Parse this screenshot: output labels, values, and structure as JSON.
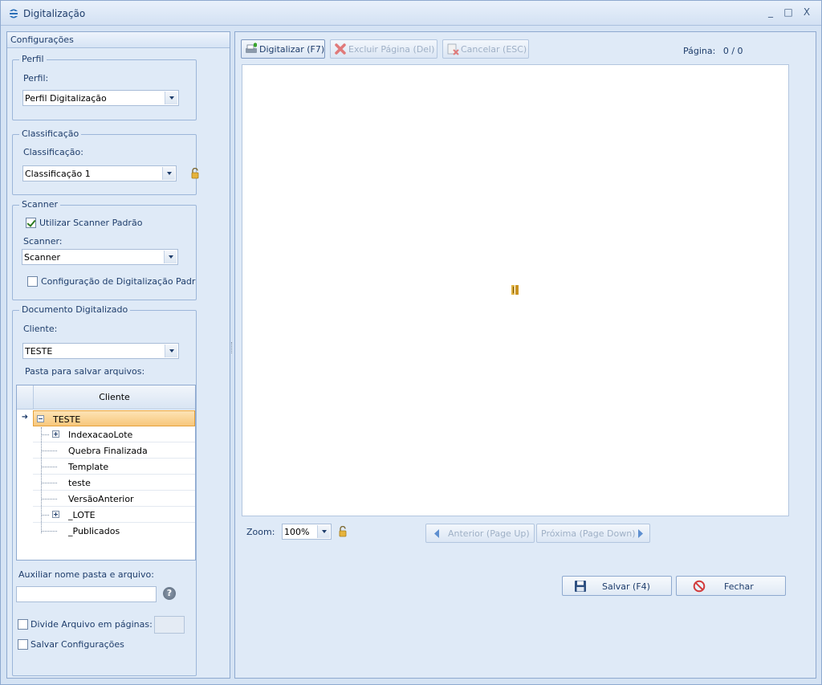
{
  "window": {
    "title": "Digitalização",
    "minimize": "_",
    "maximize": "□",
    "close": "X"
  },
  "left": {
    "header": "Configurações",
    "perfil": {
      "group_title": "Perfil",
      "label": "Perfil:",
      "value": "Perfil Digitalização"
    },
    "classificacao": {
      "group_title": "Classificação",
      "label": "Classificação:",
      "value": "Classificação 1"
    },
    "scanner": {
      "group_title": "Scanner",
      "use_default_label": "Utilizar Scanner Padrão",
      "use_default_checked": true,
      "label": "Scanner:",
      "value": "Scanner",
      "default_config_label": "Configuração de Digitalização Padrão",
      "default_config_checked": false
    },
    "documento": {
      "group_title": "Documento Digitalizado",
      "cliente_label": "Cliente:",
      "cliente_value": "TESTE",
      "pasta_label": "Pasta para salvar arquivos:",
      "tree_header": "Cliente",
      "tree_rows": [
        {
          "text": "TESTE",
          "expander": "minus",
          "selected": true
        },
        {
          "text": "IndexacaoLote",
          "expander": "plus",
          "selected": false
        },
        {
          "text": "Quebra Finalizada",
          "expander": "",
          "selected": false
        },
        {
          "text": "Template",
          "expander": "",
          "selected": false
        },
        {
          "text": "teste",
          "expander": "",
          "selected": false
        },
        {
          "text": "VersãoAnterior",
          "expander": "",
          "selected": false
        },
        {
          "text": "_LOTE",
          "expander": "plus",
          "selected": false
        },
        {
          "text": "_Publicados",
          "expander": "",
          "selected": false
        }
      ]
    },
    "auxiliar_label": "Auxiliar nome pasta e arquivo:",
    "auxiliar_value": "",
    "help_glyph": "?",
    "divide_label": "Divide Arquivo em páginas:",
    "divide_checked": false,
    "salvar_config_label": "Salvar Configurações",
    "salvar_config_checked": false
  },
  "toolbar": {
    "digitalizar": "Digitalizar (F7)",
    "excluir": "Excluir Página (Del)",
    "cancelar": "Cancelar (ESC)",
    "pagina_label": "Página:",
    "pagina_value": "0 / 0"
  },
  "bottom": {
    "zoom_label": "Zoom:",
    "zoom_value": "100%",
    "anterior": "Anterior (Page Up)",
    "proxima": "Próxima (Page Down)",
    "salvar": "Salvar (F4)",
    "fechar": "Fechar"
  },
  "colors": {
    "accent": "#1e3d6b",
    "selection": "#f7c77b",
    "panel_bg": "#dfeaf7"
  }
}
